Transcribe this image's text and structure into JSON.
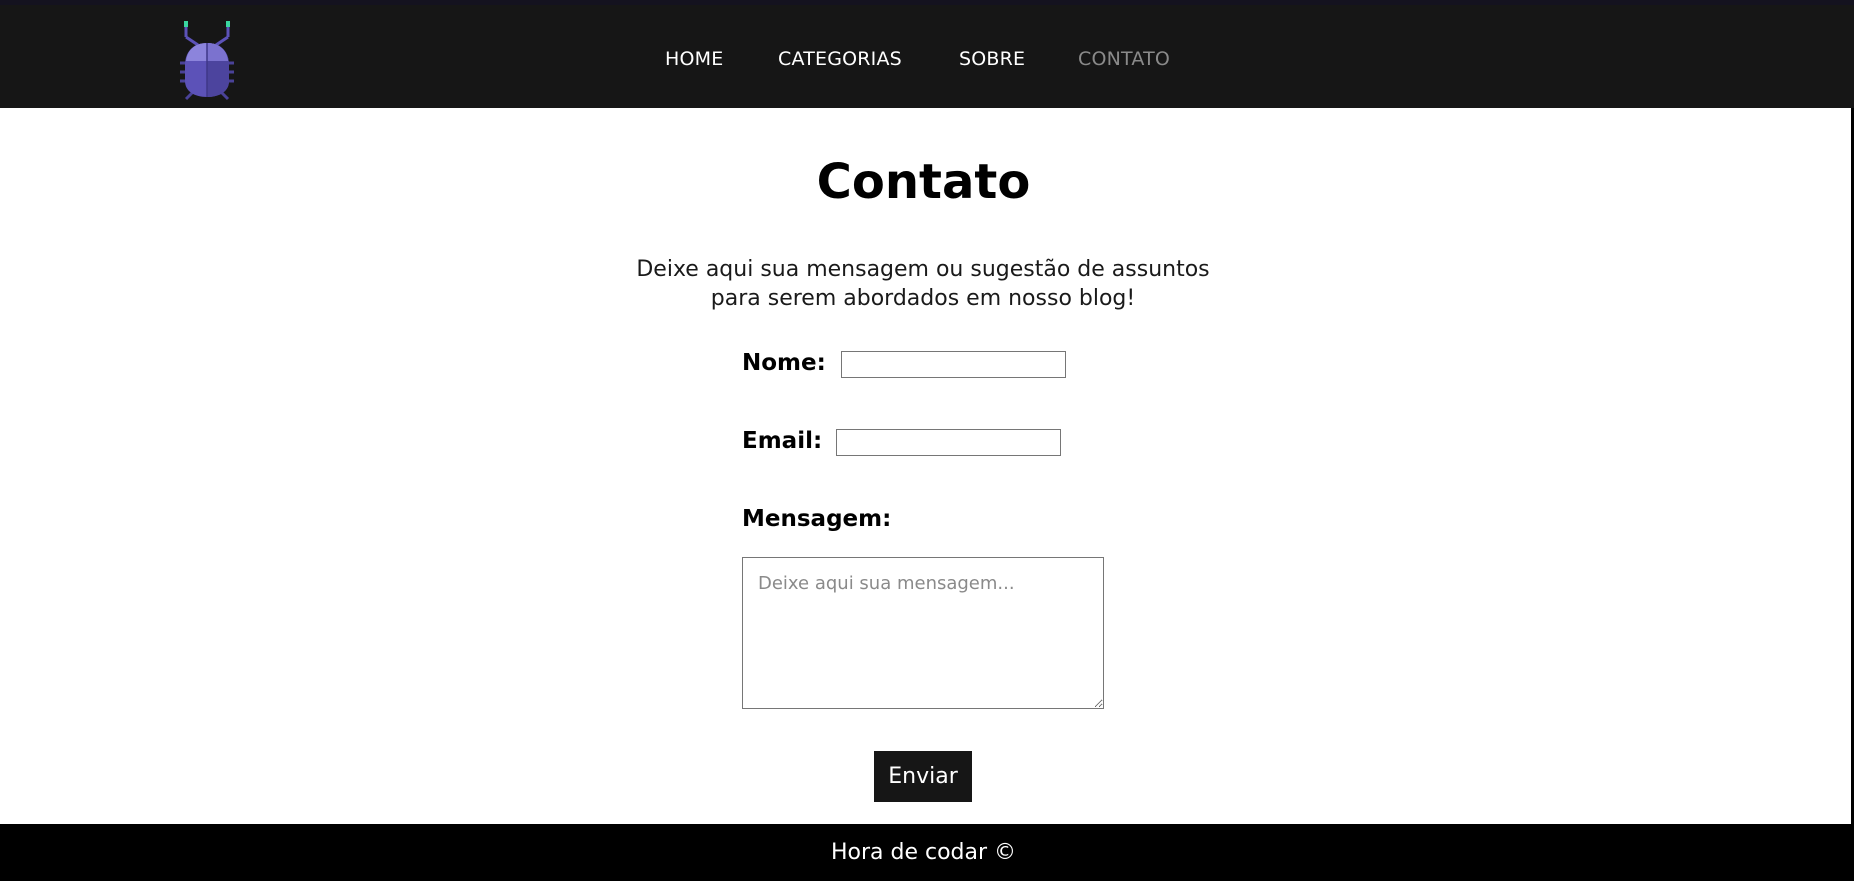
{
  "colors": {
    "navbar_background": "#161616",
    "nav_link": "#ffffff",
    "nav_link_active": "#8a8a8a",
    "logo_body": "#5c52b8",
    "logo_antenna_tip": "#3ad6a0",
    "button_background": "#161616",
    "footer_background": "#000000"
  },
  "header": {
    "logo_icon": "bug-icon",
    "nav": [
      {
        "label": "HOME",
        "active": false
      },
      {
        "label": "CATEGORIAS",
        "active": false
      },
      {
        "label": "SOBRE",
        "active": false
      },
      {
        "label": "CONTATO",
        "active": true
      }
    ]
  },
  "main": {
    "title": "Contato",
    "intro_line1": "Deixe aqui sua mensagem ou sugestão de assuntos",
    "intro_line2": "para serem abordados em nosso blog!",
    "form": {
      "name_label": "Nome:",
      "name_value": "",
      "email_label": "Email:",
      "email_value": "",
      "message_label": "Mensagem:",
      "message_placeholder": "Deixe aqui sua mensagem...",
      "message_value": "",
      "submit_label": "Enviar"
    }
  },
  "footer": {
    "text": "Hora de codar ©"
  }
}
